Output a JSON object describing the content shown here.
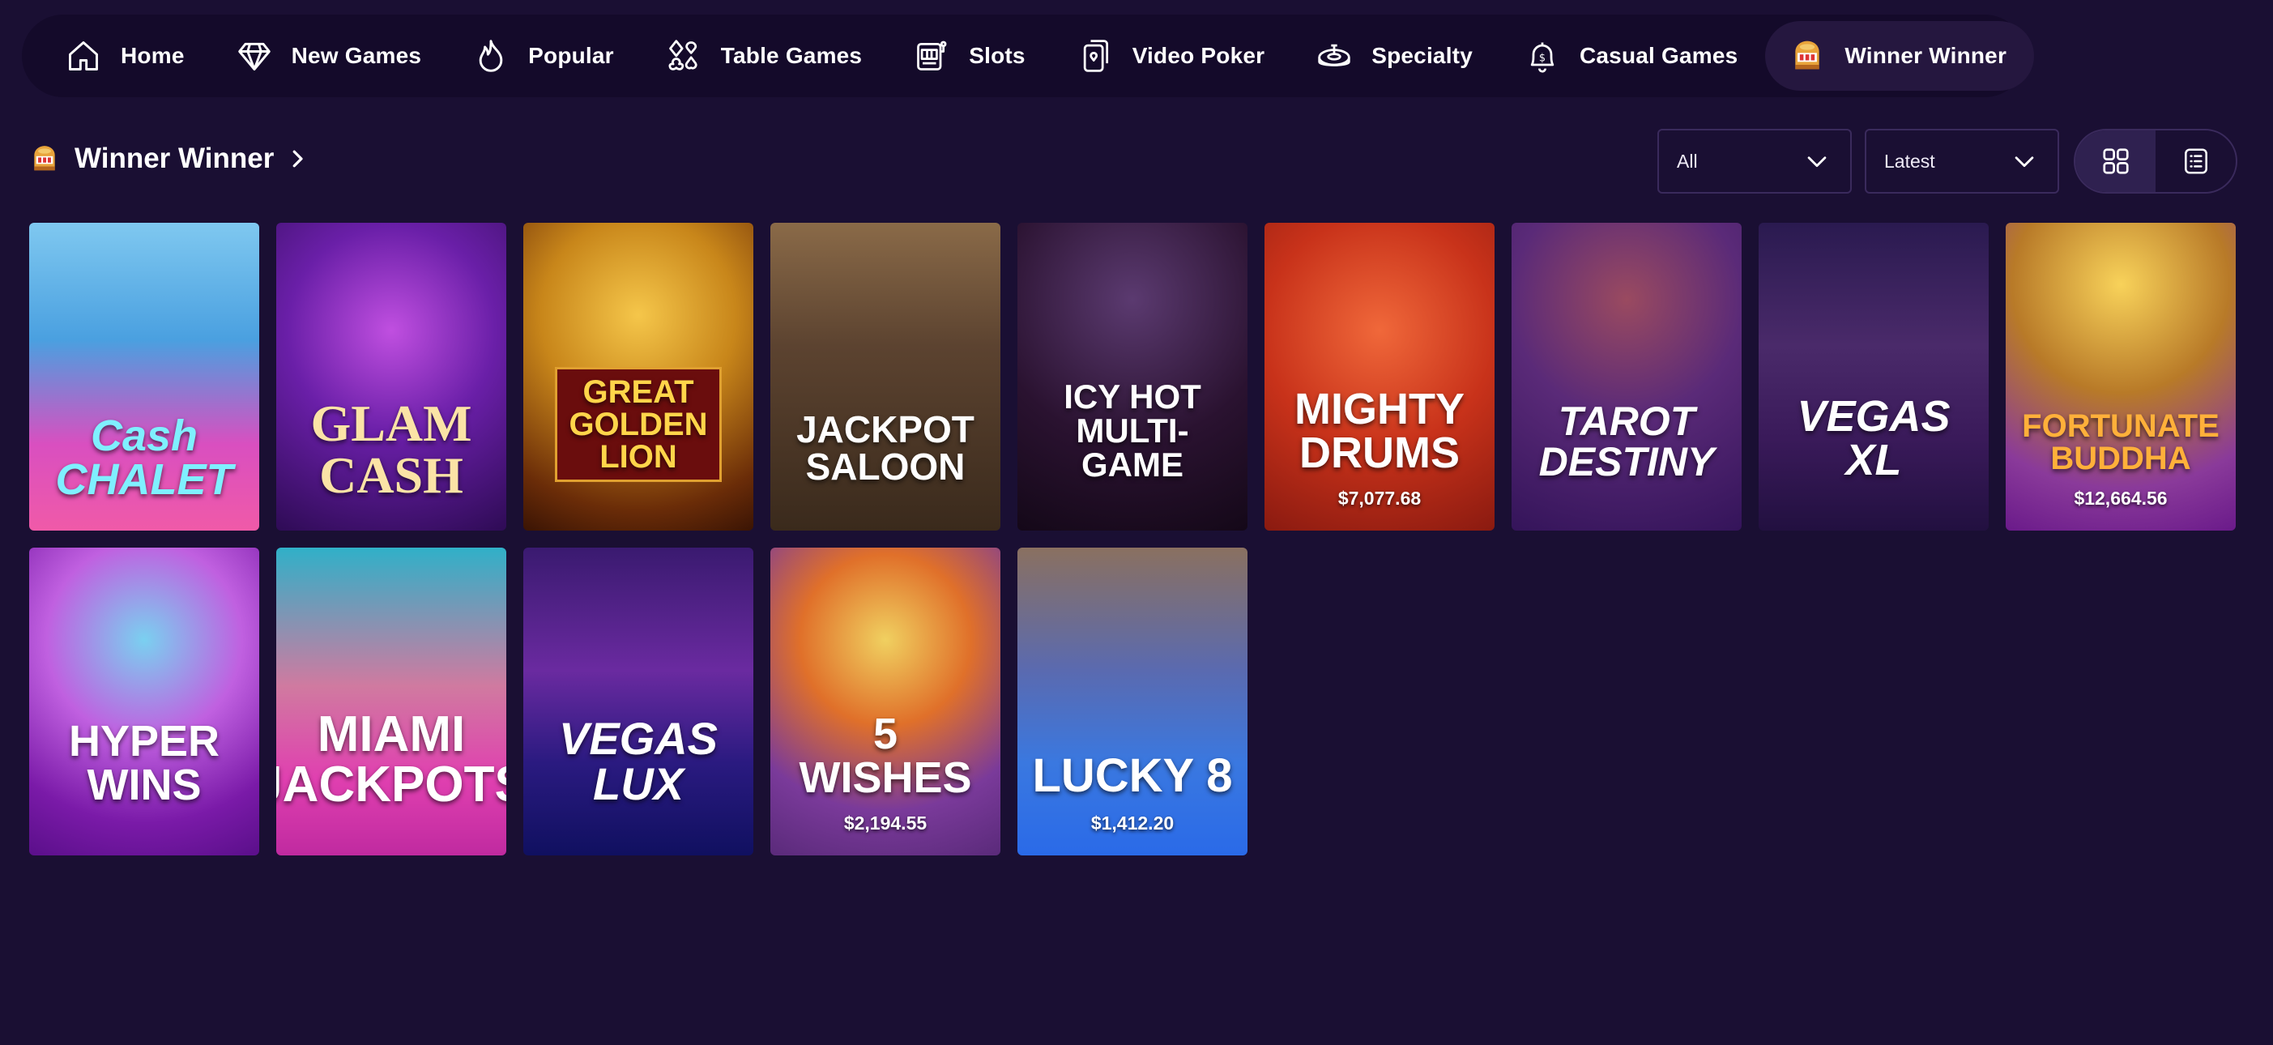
{
  "nav": {
    "items": [
      {
        "label": "Home",
        "icon": "home-icon"
      },
      {
        "label": "New Games",
        "icon": "diamond-icon"
      },
      {
        "label": "Popular",
        "icon": "flame-icon"
      },
      {
        "label": "Table Games",
        "icon": "card-suits-icon"
      },
      {
        "label": "Slots",
        "icon": "slot-machine-icon"
      },
      {
        "label": "Video Poker",
        "icon": "poker-cards-icon"
      },
      {
        "label": "Specialty",
        "icon": "roulette-icon"
      },
      {
        "label": "Casual Games",
        "icon": "bell-icon"
      },
      {
        "label": "Winner Winner",
        "icon": "winner-slot-icon",
        "active": true
      }
    ]
  },
  "section": {
    "title": "Winner Winner",
    "filter_value": "All",
    "sort_value": "Latest",
    "view_mode": "grid"
  },
  "games": [
    {
      "name": "Cash\nCHALET",
      "jackpot": ""
    },
    {
      "name": "GLAM\nCASH",
      "jackpot": ""
    },
    {
      "name": "GREAT\nGOLDEN\nLION",
      "jackpot": ""
    },
    {
      "name": "JACKPOT\nSALOON",
      "jackpot": ""
    },
    {
      "name": "ICY HOT\nMULTI-GAME",
      "jackpot": ""
    },
    {
      "name": "MIGHTY\nDRUMS",
      "jackpot": "$7,077.68"
    },
    {
      "name": "TAROT\nDESTINY",
      "jackpot": ""
    },
    {
      "name": "VEGAS\nXL",
      "jackpot": ""
    },
    {
      "name": "FORTUNATE\nBUDDHA",
      "jackpot": "$12,664.56"
    },
    {
      "name": "HYPER\nWINS",
      "jackpot": ""
    },
    {
      "name": "MIAMI\nJACKPOTS",
      "jackpot": ""
    },
    {
      "name": "VEGAS\nLUX",
      "jackpot": ""
    },
    {
      "name": "5\nWISHES",
      "jackpot": "$2,194.55"
    },
    {
      "name": "LUCKY 8",
      "jackpot": "$1,412.20"
    }
  ],
  "colors": {
    "background": "#1a0f33",
    "nav_background": "#140a2a",
    "nav_active": "#25173f",
    "border": "#3a2a5c"
  }
}
